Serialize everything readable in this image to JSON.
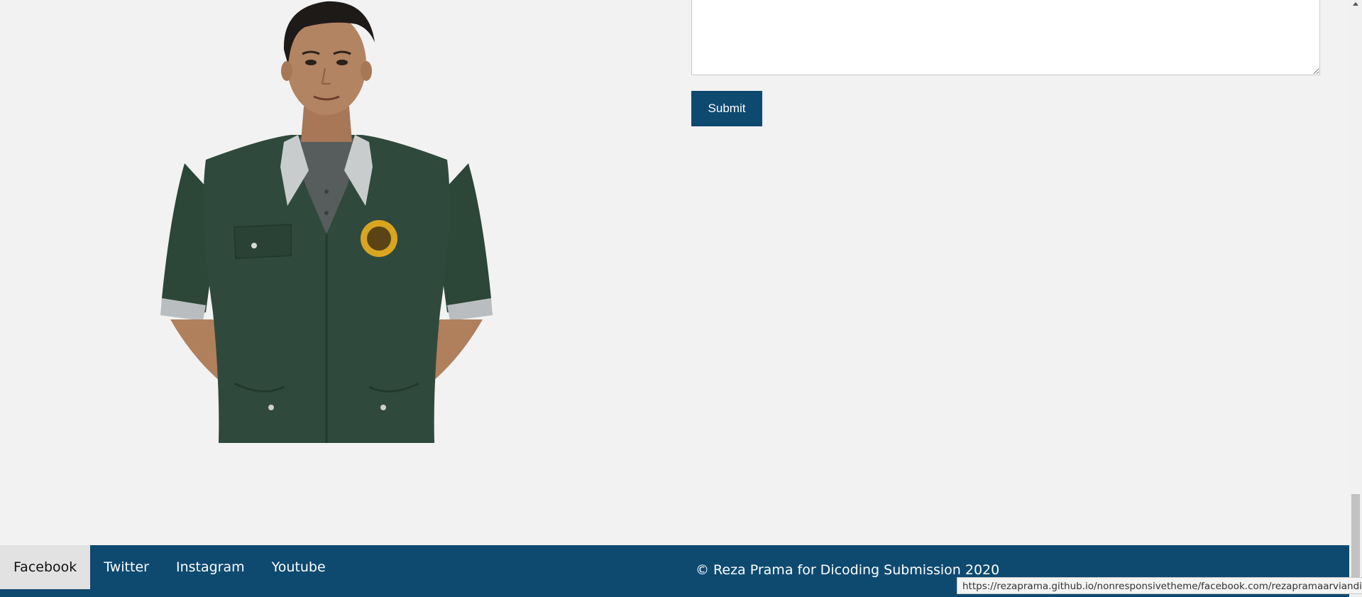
{
  "portrait": {
    "alt": "Photo of Reza Prama"
  },
  "form": {
    "message_value": "",
    "submit_label": "Submit"
  },
  "footer": {
    "links": [
      {
        "label": "Facebook",
        "active": true
      },
      {
        "label": "Twitter",
        "active": false
      },
      {
        "label": "Instagram",
        "active": false
      },
      {
        "label": "Youtube",
        "active": false
      }
    ],
    "copyright": "© Reza Prama for Dicoding Submission 2020"
  },
  "status_bar": {
    "url": "https://rezaprama.github.io/nonresponsivetheme/facebook.com/rezapramaarviandi"
  },
  "colors": {
    "page_background": "#f2f2f2",
    "brand": "#0e4a70",
    "active_link_background": "#e2e2e2",
    "jacket": "#2f4a3c",
    "badge": "#d9a520"
  }
}
